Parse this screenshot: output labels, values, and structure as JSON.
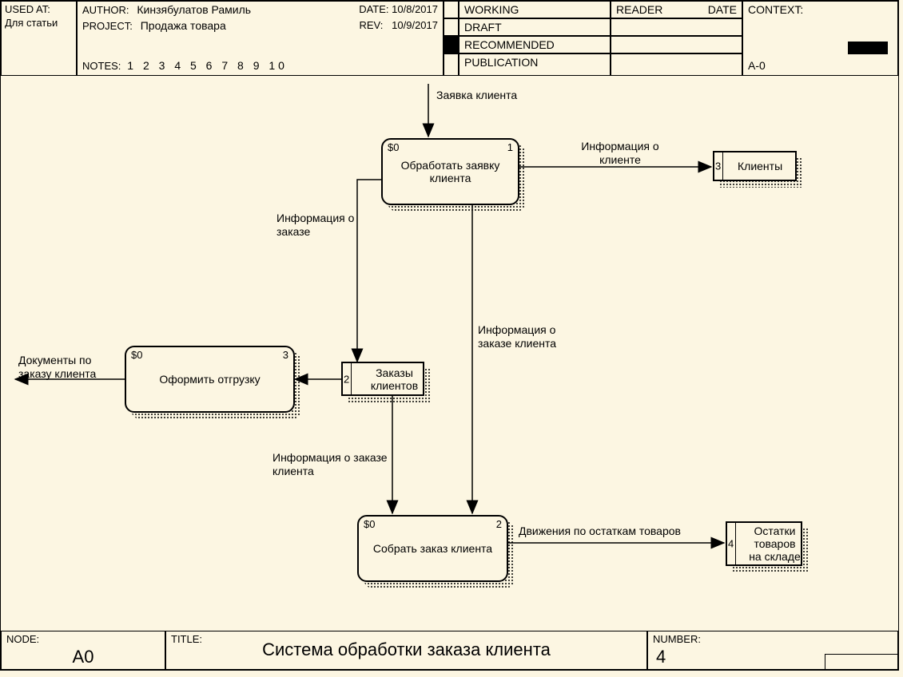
{
  "header": {
    "used_at_label": "USED AT:",
    "used_at_value": "Для статьи",
    "author_label": "AUTHOR:",
    "author_value": "Кинзябулатов Рамиль",
    "project_label": "PROJECT:",
    "project_value": "Продажа товара",
    "date_label": "DATE:",
    "date_value": "10/8/2017",
    "rev_label": "REV:",
    "rev_value": "10/9/2017",
    "notes_label": "NOTES:",
    "notes_value": "1  2  3  4  5  6  7  8  9  10",
    "status": {
      "working": "WORKING",
      "draft": "DRAFT",
      "recommended": "RECOMMENDED",
      "publication": "PUBLICATION"
    },
    "reader_label": "READER",
    "reader_date_label": "DATE",
    "context_label": "CONTEXT:",
    "context_code": "A-0"
  },
  "footer": {
    "node_label": "NODE:",
    "node_value": "A0",
    "title_label": "TITLE:",
    "title_value": "Система обработки заказа клиента",
    "number_label": "NUMBER:",
    "number_value": "4"
  },
  "diagram": {
    "a1": {
      "cost": "$0",
      "id": "1",
      "name": "Обработать заявку клиента"
    },
    "a2": {
      "cost": "$0",
      "id": "2",
      "name": "Собрать заказ клиента"
    },
    "a3": {
      "cost": "$0",
      "id": "3",
      "name": "Оформить отгрузку"
    },
    "ds2": {
      "id": "2",
      "name": "Заказы клиентов"
    },
    "ds3": {
      "id": "3",
      "name": "Клиенты"
    },
    "ds4": {
      "id": "4",
      "name": "Остатки товаров на складе"
    },
    "arrows": {
      "in_top": "Заявка клиента",
      "a1_ds3": "Информация о клиенте",
      "a1_down_left": "Информация о заказе",
      "a1_down_right": "Информация о заказе клиента",
      "ds2_a2": "Информация о заказе клиента",
      "a2_ds4": "Движения по остаткам товаров",
      "a3_out": "Документы по заказу клиента"
    }
  }
}
